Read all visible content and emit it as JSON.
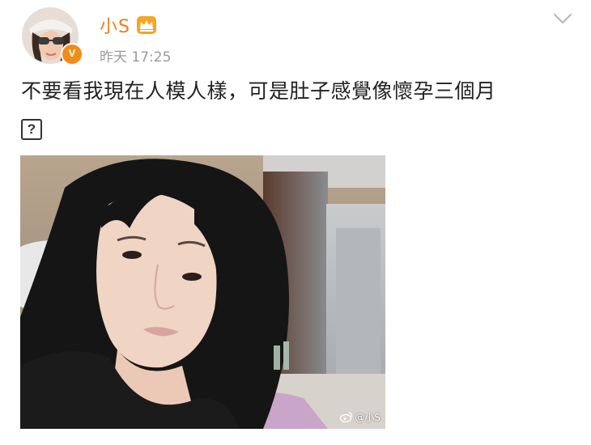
{
  "post": {
    "author": {
      "name": "小S",
      "verified_badge": "V",
      "accent_color": "#f27c1c"
    },
    "timestamp": "昨天 17:25",
    "text": "不要看我現在人模人樣，可是肚子感覺像懷孕三個月",
    "emoji_placeholder": "?",
    "image": {
      "watermark": "@小S"
    }
  },
  "icons": {
    "avatar": "avatar-icon",
    "crown": "crown-icon",
    "menu": "chevron-down-icon",
    "weibo": "weibo-logo-icon"
  }
}
